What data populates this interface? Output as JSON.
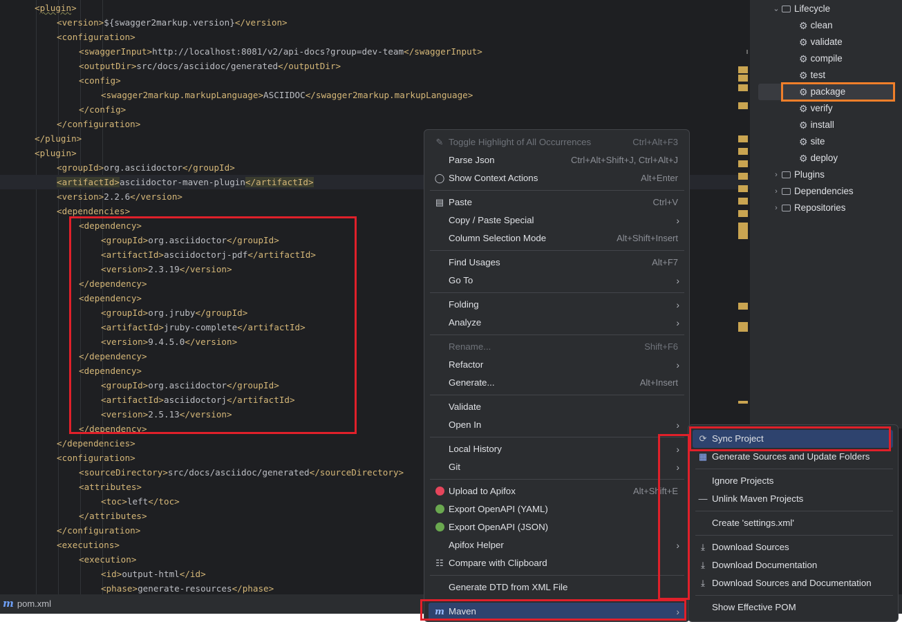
{
  "editor": {
    "lines": [
      {
        "indent": 1,
        "parts": [
          [
            "tag",
            "<"
          ],
          [
            "tagu",
            "plugin"
          ],
          [
            "tag",
            ">"
          ]
        ]
      },
      {
        "indent": 2,
        "parts": [
          [
            "tag",
            "<version>"
          ],
          [
            "txt",
            "${swagger2markup.version}"
          ],
          [
            "tag",
            "</version>"
          ]
        ]
      },
      {
        "indent": 2,
        "parts": [
          [
            "tag",
            "<configuration>"
          ]
        ]
      },
      {
        "indent": 3,
        "parts": [
          [
            "tag",
            "<swaggerInput>"
          ],
          [
            "txt",
            "http://localhost:8081/v2/api-docs?group=dev-team"
          ],
          [
            "tag",
            "</swaggerInput>"
          ]
        ]
      },
      {
        "indent": 3,
        "parts": [
          [
            "tag",
            "<outputDir>"
          ],
          [
            "txt",
            "src/docs/asciidoc/generated"
          ],
          [
            "tag",
            "</outputDir>"
          ]
        ]
      },
      {
        "indent": 3,
        "parts": [
          [
            "tag",
            "<config>"
          ]
        ]
      },
      {
        "indent": 4,
        "parts": [
          [
            "tag",
            "<swagger2markup.markupLanguage>"
          ],
          [
            "txt",
            "ASCIIDOC"
          ],
          [
            "tag",
            "</swagger2markup.markupLanguage>"
          ]
        ]
      },
      {
        "indent": 3,
        "parts": [
          [
            "tag",
            "</config>"
          ]
        ]
      },
      {
        "indent": 2,
        "parts": [
          [
            "tag",
            "</configuration>"
          ]
        ]
      },
      {
        "indent": 1,
        "parts": [
          [
            "tag",
            "</plugin>"
          ]
        ]
      },
      {
        "indent": 1,
        "parts": [
          [
            "tag",
            "<plugin>"
          ]
        ]
      },
      {
        "indent": 2,
        "parts": [
          [
            "tag",
            "<groupId>"
          ],
          [
            "txt",
            "org.asciidoctor"
          ],
          [
            "tag",
            "</groupId>"
          ]
        ]
      },
      {
        "indent": 2,
        "hl": true,
        "parts": [
          [
            "tags",
            "<artifactId>"
          ],
          [
            "txt",
            "asciidoctor-maven-plugin"
          ],
          [
            "tags",
            "</artifactId>"
          ]
        ]
      },
      {
        "indent": 2,
        "parts": [
          [
            "tag",
            "<version>"
          ],
          [
            "txt",
            "2.2.6"
          ],
          [
            "tag",
            "</version>"
          ]
        ]
      },
      {
        "indent": 2,
        "parts": [
          [
            "tag",
            "<dependencies>"
          ]
        ]
      },
      {
        "indent": 3,
        "parts": [
          [
            "tag",
            "<dependency>"
          ]
        ]
      },
      {
        "indent": 4,
        "parts": [
          [
            "tag",
            "<groupId>"
          ],
          [
            "txt",
            "org.asciidoctor"
          ],
          [
            "tag",
            "</groupId>"
          ]
        ]
      },
      {
        "indent": 4,
        "parts": [
          [
            "tag",
            "<artifactId>"
          ],
          [
            "txt",
            "asciidoctorj-pdf"
          ],
          [
            "tag",
            "</artifactId>"
          ]
        ]
      },
      {
        "indent": 4,
        "parts": [
          [
            "tag",
            "<version>"
          ],
          [
            "txt",
            "2.3.19"
          ],
          [
            "tag",
            "</version>"
          ]
        ]
      },
      {
        "indent": 3,
        "parts": [
          [
            "tag",
            "</dependency>"
          ]
        ]
      },
      {
        "indent": 3,
        "parts": [
          [
            "tag",
            "<dependency>"
          ]
        ]
      },
      {
        "indent": 4,
        "parts": [
          [
            "tag",
            "<groupId>"
          ],
          [
            "txt",
            "org.jruby"
          ],
          [
            "tag",
            "</groupId>"
          ]
        ]
      },
      {
        "indent": 4,
        "parts": [
          [
            "tag",
            "<artifactId>"
          ],
          [
            "txt",
            "jruby-complete"
          ],
          [
            "tag",
            "</artifactId>"
          ]
        ]
      },
      {
        "indent": 4,
        "parts": [
          [
            "tag",
            "<version>"
          ],
          [
            "txt",
            "9.4.5.0"
          ],
          [
            "tag",
            "</version>"
          ]
        ]
      },
      {
        "indent": 3,
        "parts": [
          [
            "tag",
            "</dependency>"
          ]
        ]
      },
      {
        "indent": 3,
        "parts": [
          [
            "tag",
            "<dependency>"
          ]
        ]
      },
      {
        "indent": 4,
        "parts": [
          [
            "tag",
            "<groupId>"
          ],
          [
            "txt",
            "org.asciidoctor"
          ],
          [
            "tag",
            "</groupId>"
          ]
        ]
      },
      {
        "indent": 4,
        "parts": [
          [
            "tag",
            "<artifactId>"
          ],
          [
            "txt",
            "asciidoctorj"
          ],
          [
            "tag",
            "</artifactId>"
          ]
        ]
      },
      {
        "indent": 4,
        "parts": [
          [
            "tag",
            "<version>"
          ],
          [
            "txt",
            "2.5.13"
          ],
          [
            "tag",
            "</version>"
          ]
        ]
      },
      {
        "indent": 3,
        "parts": [
          [
            "tag",
            "</dependency>"
          ]
        ]
      },
      {
        "indent": 2,
        "parts": [
          [
            "tag",
            "</dependencies>"
          ]
        ]
      },
      {
        "indent": 2,
        "parts": [
          [
            "tag",
            "<configuration>"
          ]
        ]
      },
      {
        "indent": 3,
        "parts": [
          [
            "tag",
            "<sourceDirectory>"
          ],
          [
            "txt",
            "src/docs/asciidoc/generated"
          ],
          [
            "tag",
            "</sourceDirectory>"
          ]
        ]
      },
      {
        "indent": 3,
        "parts": [
          [
            "tag",
            "<attributes>"
          ]
        ]
      },
      {
        "indent": 4,
        "parts": [
          [
            "tag",
            "<toc>"
          ],
          [
            "txt",
            "left"
          ],
          [
            "tag",
            "</toc>"
          ]
        ]
      },
      {
        "indent": 3,
        "parts": [
          [
            "tag",
            "</attributes>"
          ]
        ]
      },
      {
        "indent": 2,
        "parts": [
          [
            "tag",
            "</configuration>"
          ]
        ]
      },
      {
        "indent": 2,
        "parts": [
          [
            "tag",
            "<executions>"
          ]
        ]
      },
      {
        "indent": 3,
        "parts": [
          [
            "tag",
            "<execution>"
          ]
        ]
      },
      {
        "indent": 4,
        "parts": [
          [
            "tag",
            "<id>"
          ],
          [
            "txt",
            "output-html"
          ],
          [
            "tag",
            "</id>"
          ]
        ]
      },
      {
        "indent": 4,
        "parts": [
          [
            "tag",
            "<phase>"
          ],
          [
            "txt",
            "generate-resources"
          ],
          [
            "tag",
            "</phase>"
          ]
        ]
      }
    ]
  },
  "file_tab": {
    "icon": "maven-icon",
    "name": "pom.xml"
  },
  "maven_panel": {
    "lifecycle_label": "Lifecycle",
    "goals": [
      "clean",
      "validate",
      "compile",
      "test",
      "package",
      "verify",
      "install",
      "site",
      "deploy"
    ],
    "selected_goal": "package",
    "groups": [
      "Plugins",
      "Dependencies",
      "Repositories"
    ]
  },
  "context_menu": {
    "items": [
      {
        "label": "Toggle Highlight of All Occurrences",
        "shortcut": "Ctrl+Alt+F3",
        "disabled": true,
        "icon": "pen-icon"
      },
      {
        "label": "Parse Json",
        "shortcut": "Ctrl+Alt+Shift+J, Ctrl+Alt+J"
      },
      {
        "label": "Show Context Actions",
        "shortcut": "Alt+Enter",
        "icon": "bulb-icon"
      },
      {
        "sep": true
      },
      {
        "label": "Paste",
        "shortcut": "Ctrl+V",
        "icon": "clipboard-icon"
      },
      {
        "label": "Copy / Paste Special",
        "submenu": true
      },
      {
        "label": "Column Selection Mode",
        "shortcut": "Alt+Shift+Insert"
      },
      {
        "sep": true
      },
      {
        "label": "Find Usages",
        "shortcut": "Alt+F7"
      },
      {
        "label": "Go To",
        "submenu": true
      },
      {
        "sep": true
      },
      {
        "label": "Folding",
        "submenu": true
      },
      {
        "label": "Analyze",
        "submenu": true
      },
      {
        "sep": true
      },
      {
        "label": "Rename...",
        "shortcut": "Shift+F6",
        "disabled": true
      },
      {
        "label": "Refactor",
        "submenu": true
      },
      {
        "label": "Generate...",
        "shortcut": "Alt+Insert"
      },
      {
        "sep": true
      },
      {
        "label": "Validate"
      },
      {
        "label": "Open In",
        "submenu": true
      },
      {
        "sep": true
      },
      {
        "label": "Local History",
        "submenu": true
      },
      {
        "label": "Git",
        "submenu": true
      },
      {
        "sep": true
      },
      {
        "label": "Upload to Apifox",
        "shortcut": "Alt+Shift+E",
        "icon": "apifox-icon"
      },
      {
        "label": "Export OpenAPI (YAML)",
        "icon": "openapi-icon"
      },
      {
        "label": "Export OpenAPI (JSON)",
        "icon": "openapi-icon"
      },
      {
        "label": "Apifox Helper",
        "submenu": true
      },
      {
        "label": "Compare with Clipboard",
        "icon": "compare-icon"
      },
      {
        "sep": true
      },
      {
        "label": "Generate DTD from XML File"
      },
      {
        "sep": true
      },
      {
        "label": "Maven",
        "submenu": true,
        "active": true,
        "icon": "maven-icon"
      }
    ]
  },
  "submenu": {
    "items": [
      {
        "label": "Sync Project",
        "icon": "sync-icon",
        "active": true
      },
      {
        "label": "Generate Sources and Update Folders",
        "icon": "folder-sync-icon"
      },
      {
        "sep": true
      },
      {
        "label": "Ignore Projects"
      },
      {
        "label": "Unlink Maven Projects",
        "icon": "minus-icon"
      },
      {
        "sep": true
      },
      {
        "label": "Create 'settings.xml'"
      },
      {
        "sep": true
      },
      {
        "label": "Download Sources",
        "icon": "download-icon"
      },
      {
        "label": "Download Documentation",
        "icon": "download-icon"
      },
      {
        "label": "Download Sources and Documentation",
        "icon": "download-icon"
      },
      {
        "sep": true
      },
      {
        "label": "Show Effective POM"
      }
    ]
  },
  "colors": {
    "editor_bg": "#1e1f22",
    "tag": "#d5b778",
    "text": "#bcbec4",
    "menu_bg": "#2b2d30",
    "menu_active": "#2e436e",
    "annotation_red": "#e0202a",
    "annotation_orange": "#f07f2a"
  }
}
